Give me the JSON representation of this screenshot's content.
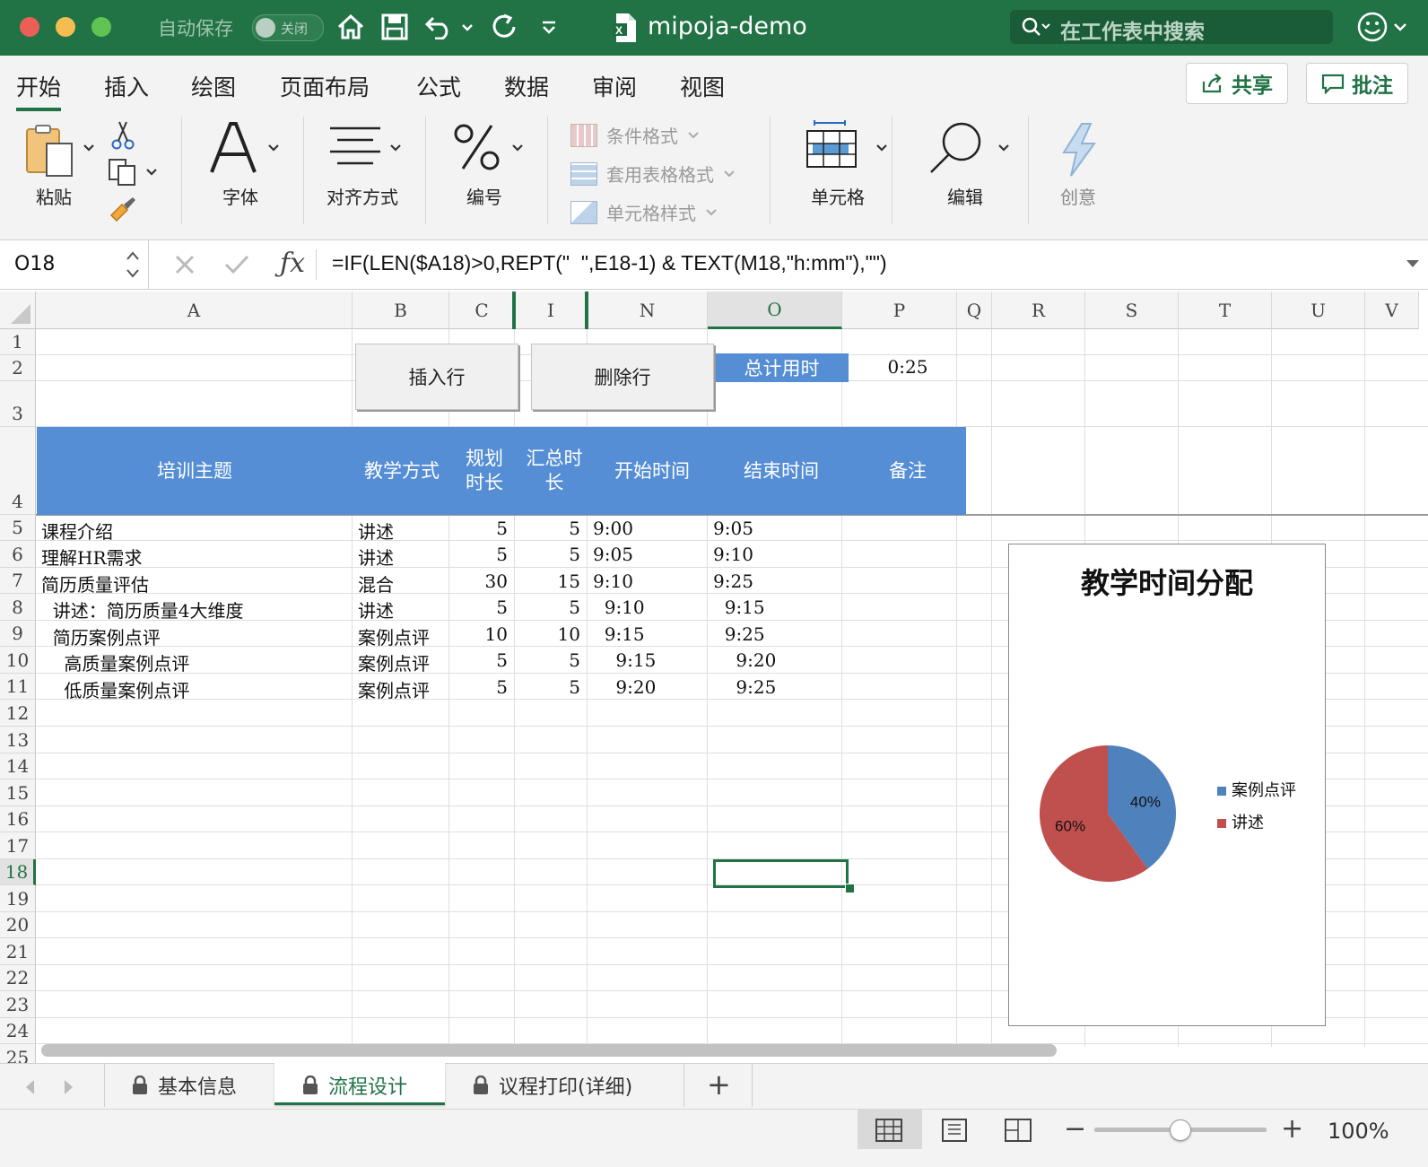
{
  "titlebar": {
    "autosave_label": "自动保存",
    "autosave_state": "关闭",
    "doc_title": "mipoja-demo",
    "search_placeholder": "在工作表中搜索"
  },
  "ribbon": {
    "tabs": [
      "开始",
      "插入",
      "绘图",
      "页面布局",
      "公式",
      "数据",
      "审阅",
      "视图"
    ],
    "share_label": "共享",
    "comments_label": "批注",
    "groups": {
      "paste": "粘贴",
      "font": "字体",
      "align": "对齐方式",
      "number": "编号",
      "conditional": "条件格式",
      "table_format": "套用表格格式",
      "cell_styles": "单元格样式",
      "cells": "单元格",
      "edit": "编辑",
      "ideas": "创意"
    }
  },
  "formula_bar": {
    "cell_ref": "O18",
    "formula": "=IF(LEN($A18)>0,REPT(\"  \",E18-1) & TEXT(M18,\"h:mm\"),\"\")"
  },
  "grid": {
    "columns": [
      "A",
      "B",
      "C",
      "I",
      "N",
      "O",
      "P",
      "Q",
      "R",
      "S",
      "T",
      "U",
      "V"
    ],
    "rows": [
      "1",
      "2",
      "3",
      "4",
      "5",
      "6",
      "7",
      "8",
      "9",
      "10",
      "11",
      "12",
      "13",
      "14",
      "15",
      "16",
      "17",
      "18",
      "19",
      "20",
      "21",
      "22",
      "23",
      "24",
      "25"
    ],
    "buttons": {
      "insert_row": "插入行",
      "delete_row": "删除行"
    },
    "total_label": "总计用时",
    "total_value": "0:25",
    "headers": [
      "培训主题",
      "教学方式",
      "规划\n时长",
      "汇总时\n长",
      "开始时间",
      "结束时间",
      "备注"
    ],
    "data_rows": [
      {
        "topic": "课程介绍",
        "method": "讲述",
        "plan": "5",
        "sum": "5",
        "start": "9:00",
        "end": "9:05"
      },
      {
        "topic": "理解HR需求",
        "method": "讲述",
        "plan": "5",
        "sum": "5",
        "start": "9:05",
        "end": "9:10"
      },
      {
        "topic": "简历质量评估",
        "method": "混合",
        "plan": "30",
        "sum": "15",
        "start": "9:10",
        "end": "9:25"
      },
      {
        "topic": "  讲述：简历质量4大维度",
        "method": "讲述",
        "plan": "5",
        "sum": "5",
        "start": "  9:10",
        "end": "  9:15"
      },
      {
        "topic": "  简历案例点评",
        "method": "案例点评",
        "plan": "10",
        "sum": "10",
        "start": "  9:15",
        "end": "  9:25"
      },
      {
        "topic": "    高质量案例点评",
        "method": "案例点评",
        "plan": "5",
        "sum": "5",
        "start": "    9:15",
        "end": "    9:20"
      },
      {
        "topic": "    低质量案例点评",
        "method": "案例点评",
        "plan": "5",
        "sum": "5",
        "start": "    9:20",
        "end": "    9:25"
      }
    ]
  },
  "chart_data": {
    "type": "pie",
    "title": "教学时间分配",
    "categories": [
      "案例点评",
      "讲述"
    ],
    "values": [
      40,
      60
    ],
    "labels": [
      "40%",
      "60%"
    ],
    "colors": [
      "#4f81bd",
      "#c0504d"
    ],
    "legend": "right"
  },
  "sheets": {
    "tabs": [
      "基本信息",
      "流程设计",
      "议程打印(详细)"
    ],
    "active": "流程设计",
    "add_label": "+"
  },
  "status": {
    "zoom": "100%",
    "zoom_minus": "−",
    "zoom_plus": "+"
  },
  "colors": {
    "excel_green": "#217346",
    "header_blue": "#558ed5"
  }
}
